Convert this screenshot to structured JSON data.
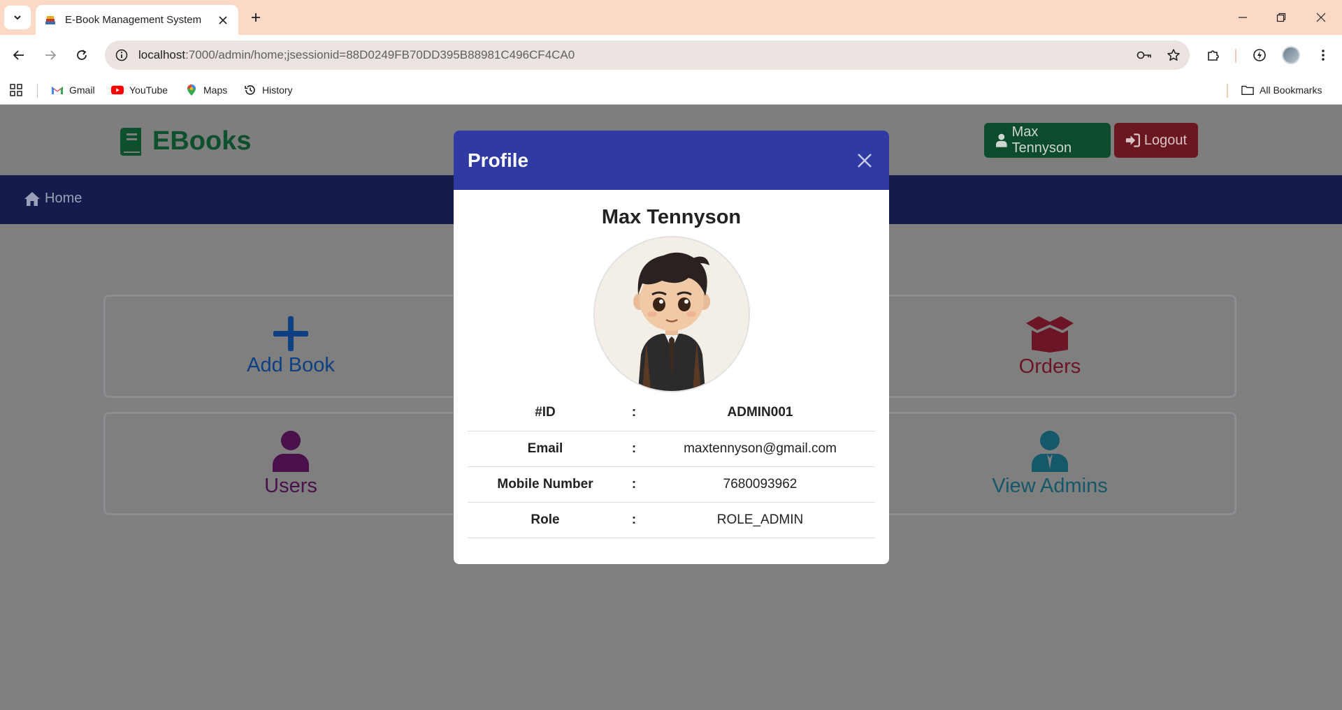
{
  "browser": {
    "tab_title": "E-Book Management System",
    "url_host": "localhost",
    "url_rest": ":7000/admin/home;jsessionid=88D0249FB70DD395B88981C496CF4CA0",
    "bookmarks": [
      {
        "label": "Gmail",
        "icon": "gmail-icon"
      },
      {
        "label": "YouTube",
        "icon": "youtube-icon"
      },
      {
        "label": "Maps",
        "icon": "maps-icon"
      },
      {
        "label": "History",
        "icon": "history-icon"
      }
    ],
    "all_bookmarks": "All Bookmarks"
  },
  "site": {
    "brand": "EBooks",
    "brand_color": "#1a7a45",
    "user_button": "Max Tennyson",
    "logout_button": "Logout",
    "nav_home": "Home"
  },
  "dashboard": {
    "cards": [
      {
        "label": "Add Book",
        "icon": "plus-icon",
        "color": "#0d47a1"
      },
      {
        "label": "Orders",
        "icon": "box-open-icon",
        "color": "#8b1a2b"
      },
      {
        "label": "Users",
        "icon": "user-icon",
        "color": "#5a1a5e"
      },
      {
        "label": "View Admins",
        "icon": "user-tie-icon",
        "color": "#1a6a7a"
      }
    ]
  },
  "profile_modal": {
    "title": "Profile",
    "name": "Max Tennyson",
    "fields": [
      {
        "label": "#ID",
        "separator": ":",
        "value": "ADMIN001"
      },
      {
        "label": "Email",
        "separator": ":",
        "value": "maxtennyson@gmail.com"
      },
      {
        "label": "Mobile Number",
        "separator": ":",
        "value": "7680093962"
      },
      {
        "label": "Role",
        "separator": ":",
        "value": "ROLE_ADMIN"
      }
    ]
  }
}
